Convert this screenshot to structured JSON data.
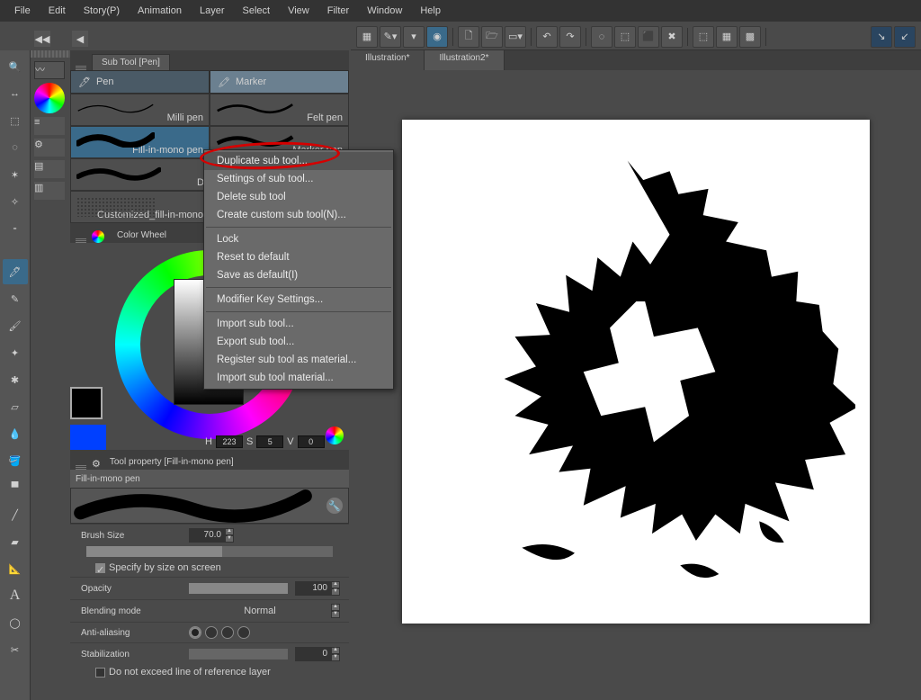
{
  "menubar": [
    "File",
    "Edit",
    "Story(P)",
    "Animation",
    "Layer",
    "Select",
    "View",
    "Filter",
    "Window",
    "Help"
  ],
  "doctabs": [
    {
      "label": "Illustration*",
      "active": false
    },
    {
      "label": "Illustration2*",
      "active": true
    }
  ],
  "subtool": {
    "tab_label": "Sub Tool [Pen]",
    "categories": [
      {
        "label": "Pen",
        "active": false
      },
      {
        "label": "Marker",
        "active": true
      }
    ],
    "left_items": [
      {
        "label": "Milli pen"
      },
      {
        "label": "Fill-in-mono pen",
        "selected": true
      },
      {
        "label": "Do"
      },
      {
        "label": "Customized_fill-in-mono"
      }
    ],
    "right_items": [
      {
        "label": "Felt pen"
      },
      {
        "label": "Marker pen"
      }
    ]
  },
  "colorwheel": {
    "tab_label": "Color Wheel",
    "H": "223",
    "S": "5",
    "V": "0"
  },
  "toolprop": {
    "tab_label": "Tool property [Fill-in-mono pen]",
    "tool_name": "Fill-in-mono pen",
    "brush_size_label": "Brush Size",
    "brush_size_value": "70.0",
    "specify_label": "Specify by size on screen",
    "opacity_label": "Opacity",
    "opacity_value": "100",
    "blend_label": "Blending mode",
    "blend_value": "Normal",
    "aa_label": "Anti-aliasing",
    "stab_label": "Stabilization",
    "stab_value": "0",
    "exceed_label": "Do not exceed line of reference layer"
  },
  "ctxmenu": [
    {
      "label": "Duplicate sub tool...",
      "highlight": true
    },
    {
      "label": "Settings of sub tool..."
    },
    {
      "label": "Delete sub tool"
    },
    {
      "label": "Create custom sub tool(N)..."
    },
    {
      "sep": true
    },
    {
      "label": "Lock"
    },
    {
      "label": "Reset to default"
    },
    {
      "label": "Save as default(I)"
    },
    {
      "sep": true
    },
    {
      "label": "Modifier Key Settings..."
    },
    {
      "sep": true
    },
    {
      "label": "Import sub tool..."
    },
    {
      "label": "Export sub tool..."
    },
    {
      "label": "Register sub tool as material..."
    },
    {
      "label": "Import sub tool material..."
    }
  ]
}
